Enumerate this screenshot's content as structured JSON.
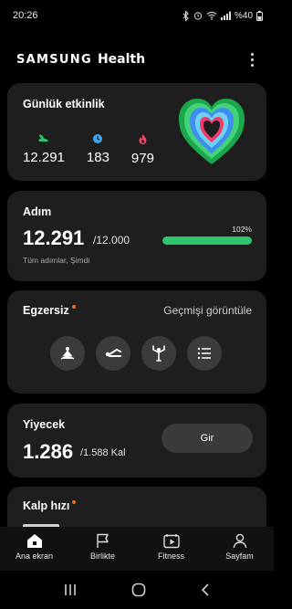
{
  "status_bar": {
    "time": "20:26",
    "battery": "%40"
  },
  "header": {
    "brand_samsung": "SAMSUNG",
    "brand_health": "Health"
  },
  "activity": {
    "title": "Günlük etkinlik",
    "steps": "12.291",
    "minutes": "183",
    "calories": "979"
  },
  "steps_card": {
    "title": "Adım",
    "count": "12.291",
    "goal": "/12.000",
    "subtitle": "Tüm adımlar, Şimdi",
    "percent_label": "102%",
    "progress": 1.0
  },
  "exercise": {
    "title": "Egzersiz",
    "history_label": "Geçmişi görüntüle"
  },
  "food": {
    "title": "Yiyecek",
    "count": "1.286",
    "goal": "/1.588 Kal",
    "enter_label": "Gir"
  },
  "heart": {
    "title": "Kalp hızı"
  },
  "nav": [
    {
      "label": "Ana ekran",
      "icon": "home-icon"
    },
    {
      "label": "Birlikte",
      "icon": "flag-icon"
    },
    {
      "label": "Fitness",
      "icon": "video-play-icon"
    },
    {
      "label": "Sayfam",
      "icon": "person-icon"
    }
  ],
  "colors": {
    "accent_green": "#2fc66b",
    "badge_orange": "#f06a2a",
    "card_bg": "#1e1e1e"
  }
}
